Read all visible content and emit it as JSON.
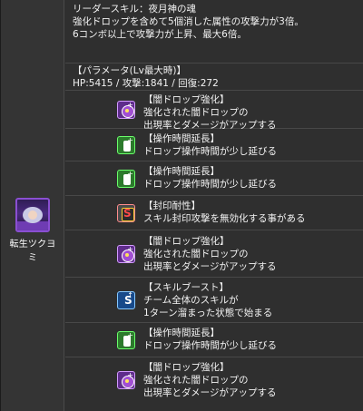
{
  "character": {
    "name": "転生ツクヨミ"
  },
  "leader_skill": {
    "title": "リーダースキル：夜月神の魂",
    "line1": "強化ドロップを含めて5個消した属性の攻撃力が3倍。",
    "line2": "6コンボ以上で攻撃力が上昇、最大6倍。"
  },
  "parameters": {
    "heading": "【パラメータ(Lv最大時)】",
    "values": "HP:5415 / 攻撃:1841 / 回復:272"
  },
  "awakenings": [
    {
      "icon": "dark-drop-boost-icon",
      "title": "【闇ドロップ強化】",
      "desc1": "強化された闇ドロップの",
      "desc2": "出現率とダメージがアップする"
    },
    {
      "icon": "time-extend-icon",
      "title": "【操作時間延長】",
      "desc1": "ドロップ操作時間が少し延びる",
      "desc2": ""
    },
    {
      "icon": "time-extend-icon",
      "title": "【操作時間延長】",
      "desc1": "ドロップ操作時間が少し延びる",
      "desc2": ""
    },
    {
      "icon": "skill-bind-resist-icon",
      "title": "【封印耐性】",
      "desc1": "スキル封印攻撃を無効化する事がある",
      "desc2": ""
    },
    {
      "icon": "dark-drop-boost-icon",
      "title": "【闇ドロップ強化】",
      "desc1": "強化された闇ドロップの",
      "desc2": "出現率とダメージがアップする"
    },
    {
      "icon": "skill-boost-icon",
      "title": "【スキルブースト】",
      "desc1": "チーム全体のスキルが",
      "desc2": "1ターン溜まった状態で始まる"
    },
    {
      "icon": "time-extend-icon",
      "title": "【操作時間延長】",
      "desc1": "ドロップ操作時間が少し延びる",
      "desc2": ""
    },
    {
      "icon": "dark-drop-boost-icon",
      "title": "【闇ドロップ強化】",
      "desc1": "強化された闇ドロップの",
      "desc2": "出現率とダメージがアップする"
    }
  ]
}
